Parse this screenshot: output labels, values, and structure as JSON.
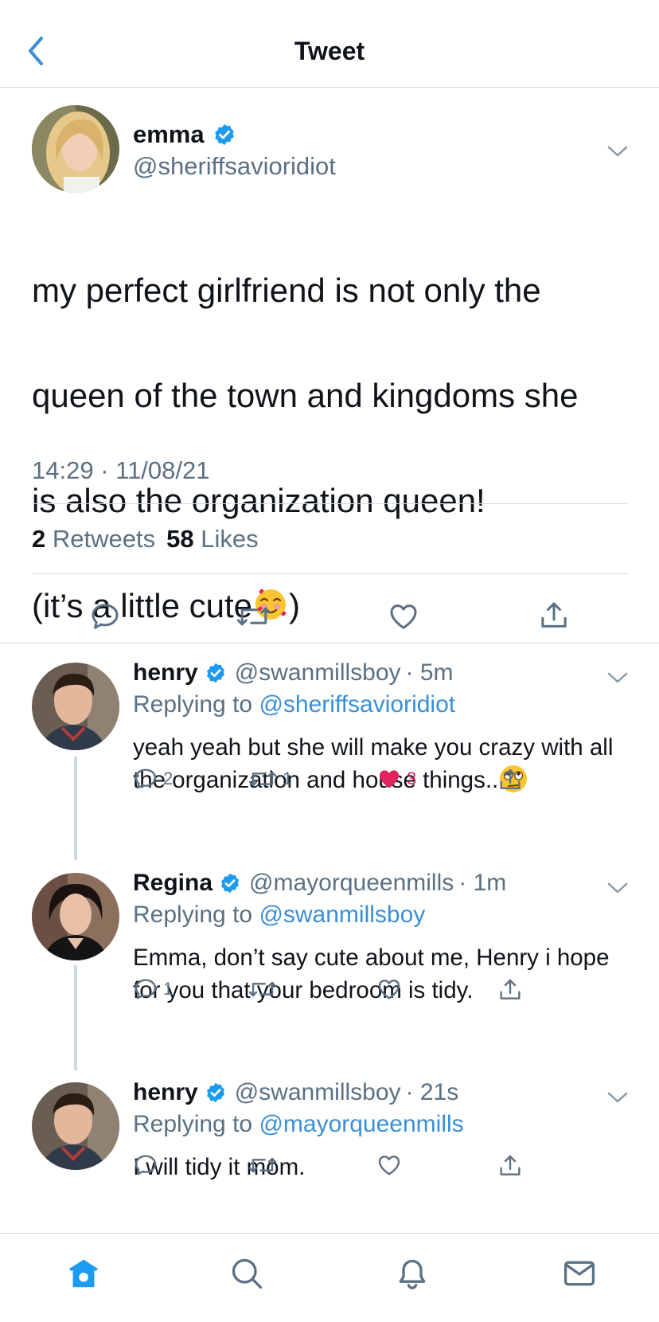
{
  "header": {
    "title": "Tweet"
  },
  "main_tweet": {
    "name": "emma",
    "handle": "@sheriffsavioridiot",
    "text_line1": "my perfect girlfriend is not only the",
    "text_line2": "queen of the town and kingdoms she",
    "text_line3": "is also the organization queen!",
    "text_line4_start": "(it’s a little cute",
    "text_line4_end": ")",
    "timestamp": "14:29 · 11/08/21",
    "retweets_count": "2",
    "retweets_label": "Retweets",
    "likes_count": "58",
    "likes_label": "Likes"
  },
  "replies": [
    {
      "name": "henry",
      "handle": "@swanmillsboy",
      "time": "· 5m",
      "replying_prefix": "Replying to",
      "replying_to": "@sheriffsavioridiot",
      "text": "yeah yeah but she will make you crazy with all the organization and house things..",
      "reply_count": "2",
      "retweet_count": "1",
      "like_count": "3"
    },
    {
      "name": "Regina",
      "handle": "@mayorqueenmills",
      "time": "· 1m",
      "replying_prefix": "Replying to",
      "replying_to": "@swanmillsboy",
      "text": "Emma, don’t say cute about me, Henry i hope for you that your bedroom is tidy.",
      "reply_count": "1"
    },
    {
      "name": "henry",
      "handle": "@swanmillsboy",
      "time": "· 21s",
      "replying_prefix": "Replying to",
      "replying_to": "@mayorqueenmills",
      "text": "I will tidy it mom."
    }
  ],
  "colors": {
    "accent": "#1d9bf0",
    "link": "#3b8fd6",
    "like": "#e0245e",
    "muted": "#5b7083"
  },
  "icons": {
    "back": "chevron-left-icon",
    "verified": "verified-badge-icon",
    "reply": "reply-icon",
    "retweet": "retweet-icon",
    "like": "heart-icon",
    "share": "share-icon",
    "home": "home-icon",
    "search": "search-icon",
    "notifications": "bell-icon",
    "messages": "mail-icon"
  }
}
